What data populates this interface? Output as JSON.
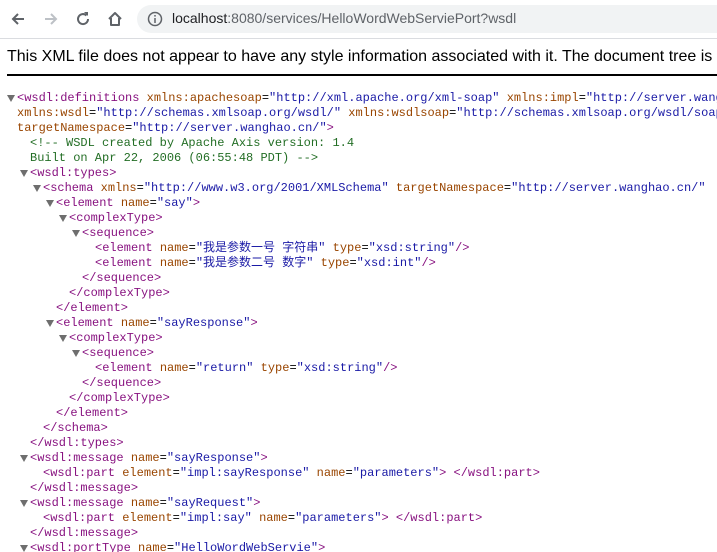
{
  "browser": {
    "url_host": "localhost",
    "url_path": ":8080/services/HelloWordWebServiePort?wsdl",
    "icons": {
      "back": "back-arrow-icon",
      "forward": "forward-arrow-icon",
      "reload": "reload-icon",
      "home": "home-icon",
      "info": "info-circle-icon"
    }
  },
  "banner": {
    "text": "This XML file does not appear to have any style information associated with it. The document tree is shown below."
  },
  "xml": {
    "l1": {
      "tag": "<wsdl:definitions",
      "a1n": "xmlns:apachesoap",
      "a1v": "\"http://xml.apache.org/xml-soap\"",
      "a2n": "xmlns:impl",
      "a2v": "\"http://server.wanghao.cn/\""
    },
    "l2": {
      "a1n": "xmlns:wsdl",
      "a1v": "\"http://schemas.xmlsoap.org/wsdl/\"",
      "a2n": "xmlns:wsdlsoap",
      "a2v": "\"http://schemas.xmlsoap.org/wsdl/soap/\""
    },
    "l3": {
      "a1n": "targetNamespace",
      "a1v": "\"http://server.wanghao.cn/\"",
      "end": ">"
    },
    "comment1": "<!-- WSDL created by Apache Axis version: 1.4",
    "comment2": "Built on Apr 22, 2006 (06:55:48 PDT) -->",
    "types_open": "<wsdl:types>",
    "schema": {
      "tag": "<schema",
      "a1n": "xmlns",
      "a1v": "\"http://www.w3.org/2001/XMLSchema\"",
      "a2n": "targetNamespace",
      "a2v": "\"http://server.wanghao.cn/\""
    },
    "el_say": {
      "tag": "<element",
      "a1n": "name",
      "a1v": "\"say\"",
      "end": ">"
    },
    "complex_open": "<complexType>",
    "seq_open": "<sequence>",
    "el_p1": {
      "tag": "<element",
      "a1n": "name",
      "a1v": "\"我是参数一号 字符串\"",
      "a2n": "type",
      "a2v": "\"xsd:string\"",
      "end": "/>"
    },
    "el_p2": {
      "tag": "<element",
      "a1n": "name",
      "a1v": "\"我是参数二号 数字\"",
      "a2n": "type",
      "a2v": "\"xsd:int\"",
      "end": "/>"
    },
    "seq_close": "</sequence>",
    "complex_close": "</complexType>",
    "element_close": "</element>",
    "el_resp": {
      "tag": "<element",
      "a1n": "name",
      "a1v": "\"sayResponse\"",
      "end": ">"
    },
    "el_ret": {
      "tag": "<element",
      "a1n": "name",
      "a1v": "\"return\"",
      "a2n": "type",
      "a2v": "\"xsd:string\"",
      "end": "/>"
    },
    "schema_close": "</schema>",
    "types_close": "</wsdl:types>",
    "msg_resp": {
      "tag": "<wsdl:message",
      "a1n": "name",
      "a1v": "\"sayResponse\"",
      "end": ">"
    },
    "part_resp": {
      "tag": "<wsdl:part",
      "a1n": "element",
      "a1v": "\"impl:sayResponse\"",
      "a2n": "name",
      "a2v": "\"parameters\"",
      "end": ">",
      "close": "</wsdl:part>"
    },
    "msg_close": "</wsdl:message>",
    "msg_req": {
      "tag": "<wsdl:message",
      "a1n": "name",
      "a1v": "\"sayRequest\"",
      "end": ">"
    },
    "part_req": {
      "tag": "<wsdl:part",
      "a1n": "element",
      "a1v": "\"impl:say\"",
      "a2n": "name",
      "a2v": "\"parameters\"",
      "end": ">",
      "close": "</wsdl:part>"
    },
    "porttype": {
      "tag": "<wsdl:portType",
      "a1n": "name",
      "a1v": "\"HelloWordWebServie\"",
      "end": ">"
    }
  }
}
